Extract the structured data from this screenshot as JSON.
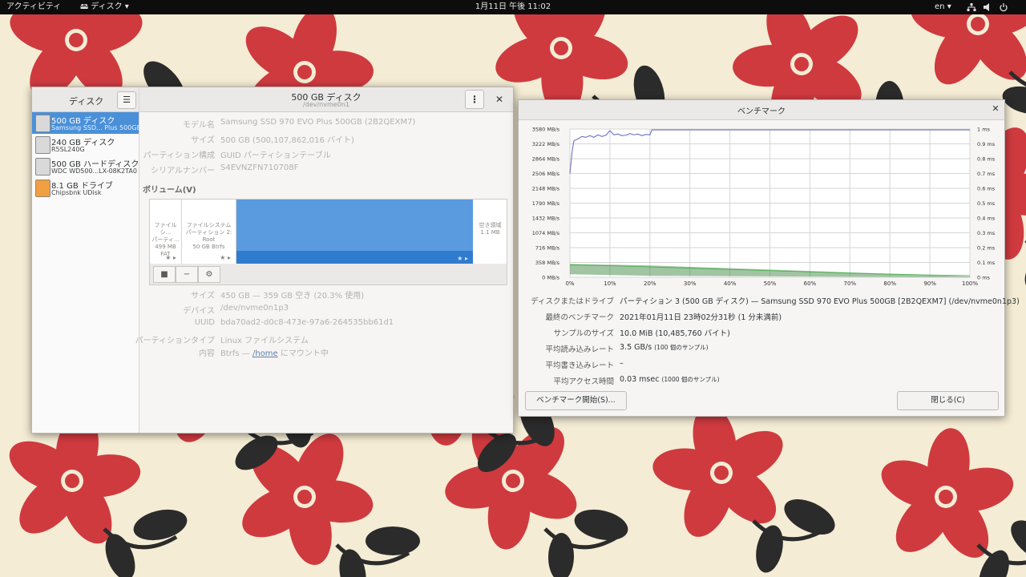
{
  "topbar": {
    "activities": "アクティビティ",
    "app_menu": "ディスク",
    "clock": "1月11日 午後 11:02",
    "lang": "en",
    "icons": [
      "network-icon",
      "volume-icon",
      "power-icon"
    ]
  },
  "disks": {
    "sidebar_title": "ディスク",
    "menu_icon": "hamburger-icon",
    "drives": [
      {
        "name": "500 GB ディスク",
        "model": "Samsung SSD... Plus 500GB",
        "selected": true,
        "icon": "ssd-icon"
      },
      {
        "name": "240 GB ディスク",
        "model": "R5SL240G",
        "selected": false,
        "icon": "ssd-icon"
      },
      {
        "name": "500 GB ハードディスク",
        "model": "WDC WD500...LX-08K2TA0",
        "selected": false,
        "icon": "hdd-icon"
      },
      {
        "name": "8.1 GB ドライブ",
        "model": "Chipsbnk UDisk",
        "selected": false,
        "icon": "usb-drive-icon"
      }
    ],
    "title": "500 GB ディスク",
    "path": "/dev/nvme0n1",
    "properties": [
      {
        "label": "モデル名",
        "value": "Samsung SSD 970 EVO Plus 500GB (2B2QEXM7)"
      },
      {
        "label": "サイズ",
        "value": "500 GB (500,107,862,016 バイト)"
      },
      {
        "label": "パーティション構成",
        "value": "GUID パーティションテーブル"
      },
      {
        "label": "シリアルナンバー",
        "value": "S4EVNZFN710708F"
      }
    ],
    "volumes_label": "ボリューム(V)",
    "volumes": [
      {
        "line1": "ファイルシ...",
        "line2": "パーティ...",
        "line3": "499 MB FAT"
      },
      {
        "line1": "ファイルシステム",
        "line2": "パーティション 2: Root",
        "line3": "50 GB Btrfs"
      },
      {
        "line1": "",
        "line2": "",
        "line3": ""
      },
      {
        "line1": "空き領域",
        "line2": "1.1 MB",
        "line3": ""
      }
    ],
    "volume_properties": [
      {
        "label": "サイズ",
        "value": "450 GB — 359 GB 空き (20.3% 使用)"
      },
      {
        "label": "デバイス",
        "value": "/dev/nvme0n1p3"
      },
      {
        "label": "UUID",
        "value": "bda70ad2-d0c8-473e-97a6-264535bb61d1"
      },
      {
        "label": "パーティションタイプ",
        "value": "Linux ファイルシステム"
      }
    ],
    "content_label": "内容",
    "content_prefix": "Btrfs — ",
    "content_link": "/home",
    "content_suffix": " にマウント中"
  },
  "benchmark": {
    "title": "ベンチマーク",
    "info": [
      {
        "label": "ディスクまたはドライブ",
        "value": "パーティション 3 (500 GB ディスク) — Samsung SSD 970 EVO Plus 500GB [2B2QEXM7] (/dev/nvme0n1p3)",
        "note": ""
      },
      {
        "label": "最終のベンチマーク",
        "value": "2021年01月11日 23時02分31秒 (1 分未満前)",
        "note": ""
      },
      {
        "label": "サンプルのサイズ",
        "value": "10.0 MiB (10,485,760 バイト)",
        "note": ""
      },
      {
        "label": "平均読み込みレート",
        "value": "3.5 GB/s ",
        "note": "(100 個のサンプル)"
      },
      {
        "label": "平均書き込みレート",
        "value": "–",
        "note": ""
      },
      {
        "label": "平均アクセス時間",
        "value": "0.03 msec ",
        "note": "(1000 個のサンプル)"
      }
    ],
    "start_button": "ベンチマーク開始(S)...",
    "close_button": "閉じる(C)"
  },
  "chart_data": {
    "type": "line",
    "title": "",
    "xlabel": "",
    "ylabel": "",
    "x_ticks": [
      "0%",
      "10%",
      "20%",
      "30%",
      "40%",
      "50%",
      "60%",
      "70%",
      "80%",
      "90%",
      "100%"
    ],
    "y_ticks_left": [
      "0 MB/s",
      "358 MB/s",
      "716 MB/s",
      "1074 MB/s",
      "1432 MB/s",
      "1790 MB/s",
      "2148 MB/s",
      "2506 MB/s",
      "2864 MB/s",
      "3222 MB/s",
      "3580 MB/s"
    ],
    "y_ticks_right": [
      "0 ms",
      "0.1 ms",
      "0.2 ms",
      "0.3 ms",
      "0.4 ms",
      "0.5 ms",
      "0.6 ms",
      "0.7 ms",
      "0.8 ms",
      "0.9 ms",
      "1 ms"
    ],
    "xlim": [
      0,
      100
    ],
    "ylim_left": [
      0,
      3580
    ],
    "ylim_right": [
      0,
      1
    ],
    "grid": true,
    "series": [
      {
        "color": "#6c71c4",
        "x": [
          0,
          0.5,
          1,
          2,
          3,
          4,
          5,
          6,
          7,
          8,
          9,
          10,
          11,
          12,
          13,
          14,
          15,
          16,
          17,
          18,
          19,
          20,
          20.5,
          25,
          30,
          40,
          50,
          60,
          70,
          80,
          90,
          100
        ],
        "y": [
          2500,
          3000,
          3300,
          3340,
          3400,
          3380,
          3420,
          3380,
          3440,
          3400,
          3430,
          3540,
          3440,
          3460,
          3420,
          3430,
          3470,
          3440,
          3460,
          3420,
          3450,
          3440,
          3560,
          3560,
          3560,
          3560,
          3560,
          3560,
          3560,
          3560,
          3560,
          3560
        ]
      },
      {
        "color": "#4caf50",
        "x": [
          0,
          10,
          20,
          30,
          40,
          50,
          60,
          70,
          80,
          90,
          100
        ],
        "y": [
          300,
          280,
          250,
          220,
          190,
          160,
          130,
          100,
          75,
          55,
          40
        ]
      }
    ],
    "access_time_band": {
      "color": "#2e7d32",
      "x": [
        0,
        20,
        100
      ],
      "y_top_ms": [
        0.09,
        0.08,
        0.005
      ],
      "y_bottom_ms": [
        0.02,
        0.01,
        0.0
      ]
    }
  }
}
